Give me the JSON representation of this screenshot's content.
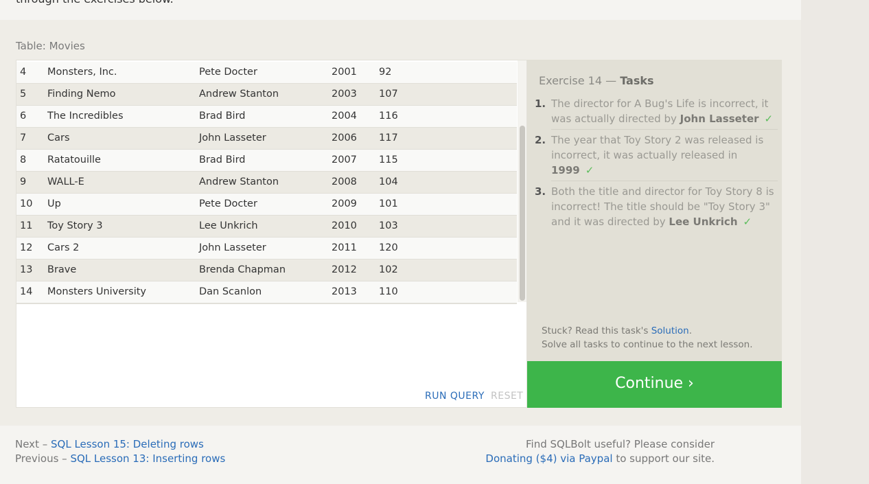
{
  "intro": {
    "text": "through the exercises below."
  },
  "table": {
    "caption": "Table: Movies",
    "rows": [
      {
        "id": "4",
        "title": "Monsters, Inc.",
        "director": "Pete Docter",
        "year": "2001",
        "length": "92"
      },
      {
        "id": "5",
        "title": "Finding Nemo",
        "director": "Andrew Stanton",
        "year": "2003",
        "length": "107"
      },
      {
        "id": "6",
        "title": "The Incredibles",
        "director": "Brad Bird",
        "year": "2004",
        "length": "116"
      },
      {
        "id": "7",
        "title": "Cars",
        "director": "John Lasseter",
        "year": "2006",
        "length": "117"
      },
      {
        "id": "8",
        "title": "Ratatouille",
        "director": "Brad Bird",
        "year": "2007",
        "length": "115"
      },
      {
        "id": "9",
        "title": "WALL-E",
        "director": "Andrew Stanton",
        "year": "2008",
        "length": "104"
      },
      {
        "id": "10",
        "title": "Up",
        "director": "Pete Docter",
        "year": "2009",
        "length": "101"
      },
      {
        "id": "11",
        "title": "Toy Story 3",
        "director": "Lee Unkrich",
        "year": "2010",
        "length": "103"
      },
      {
        "id": "12",
        "title": "Cars 2",
        "director": "John Lasseter",
        "year": "2011",
        "length": "120"
      },
      {
        "id": "13",
        "title": "Brave",
        "director": "Brenda Chapman",
        "year": "2012",
        "length": "102"
      },
      {
        "id": "14",
        "title": "Monsters University",
        "director": "Dan Scanlon",
        "year": "2013",
        "length": "110"
      }
    ]
  },
  "query": {
    "run_label": "RUN QUERY",
    "reset_label": "RESET"
  },
  "tasks": {
    "heading_prefix": "Exercise 14 — ",
    "heading_strong": "Tasks",
    "items": [
      {
        "num": "1.",
        "text": "The director for A Bug's Life is incorrect, it was actually directed by ",
        "strong": "John Lasseter",
        "check": "✓"
      },
      {
        "num": "2.",
        "text": "The year that Toy Story 2 was released is incorrect, it was actually released in ",
        "strong": "1999",
        "check": "✓"
      },
      {
        "num": "3.",
        "text": "Both the title and director for Toy Story 8 is incorrect! The title should be \"Toy Story 3\" and it was directed by ",
        "strong": "Lee Unkrich",
        "check": "✓"
      }
    ],
    "stuck_prefix": "Stuck? Read this task's ",
    "solution_label": "Solution",
    "stuck_suffix": ".",
    "solve_all": "Solve all tasks to continue to the next lesson."
  },
  "continue": {
    "label": "Continue ›"
  },
  "footer": {
    "next_prefix": "Next – ",
    "next_link": "SQL Lesson 15: Deleting rows",
    "previous_prefix": "Previous – ",
    "previous_link": "SQL Lesson 13: Inserting rows",
    "support_line1": "Find SQLBolt useful? Please consider",
    "donate_link": "Donating ($4) via Paypal",
    "support_suffix": " to support our site."
  },
  "colors": {
    "accent": "#3db54a",
    "link": "#2a6cb8",
    "check": "#5cbd5c"
  }
}
